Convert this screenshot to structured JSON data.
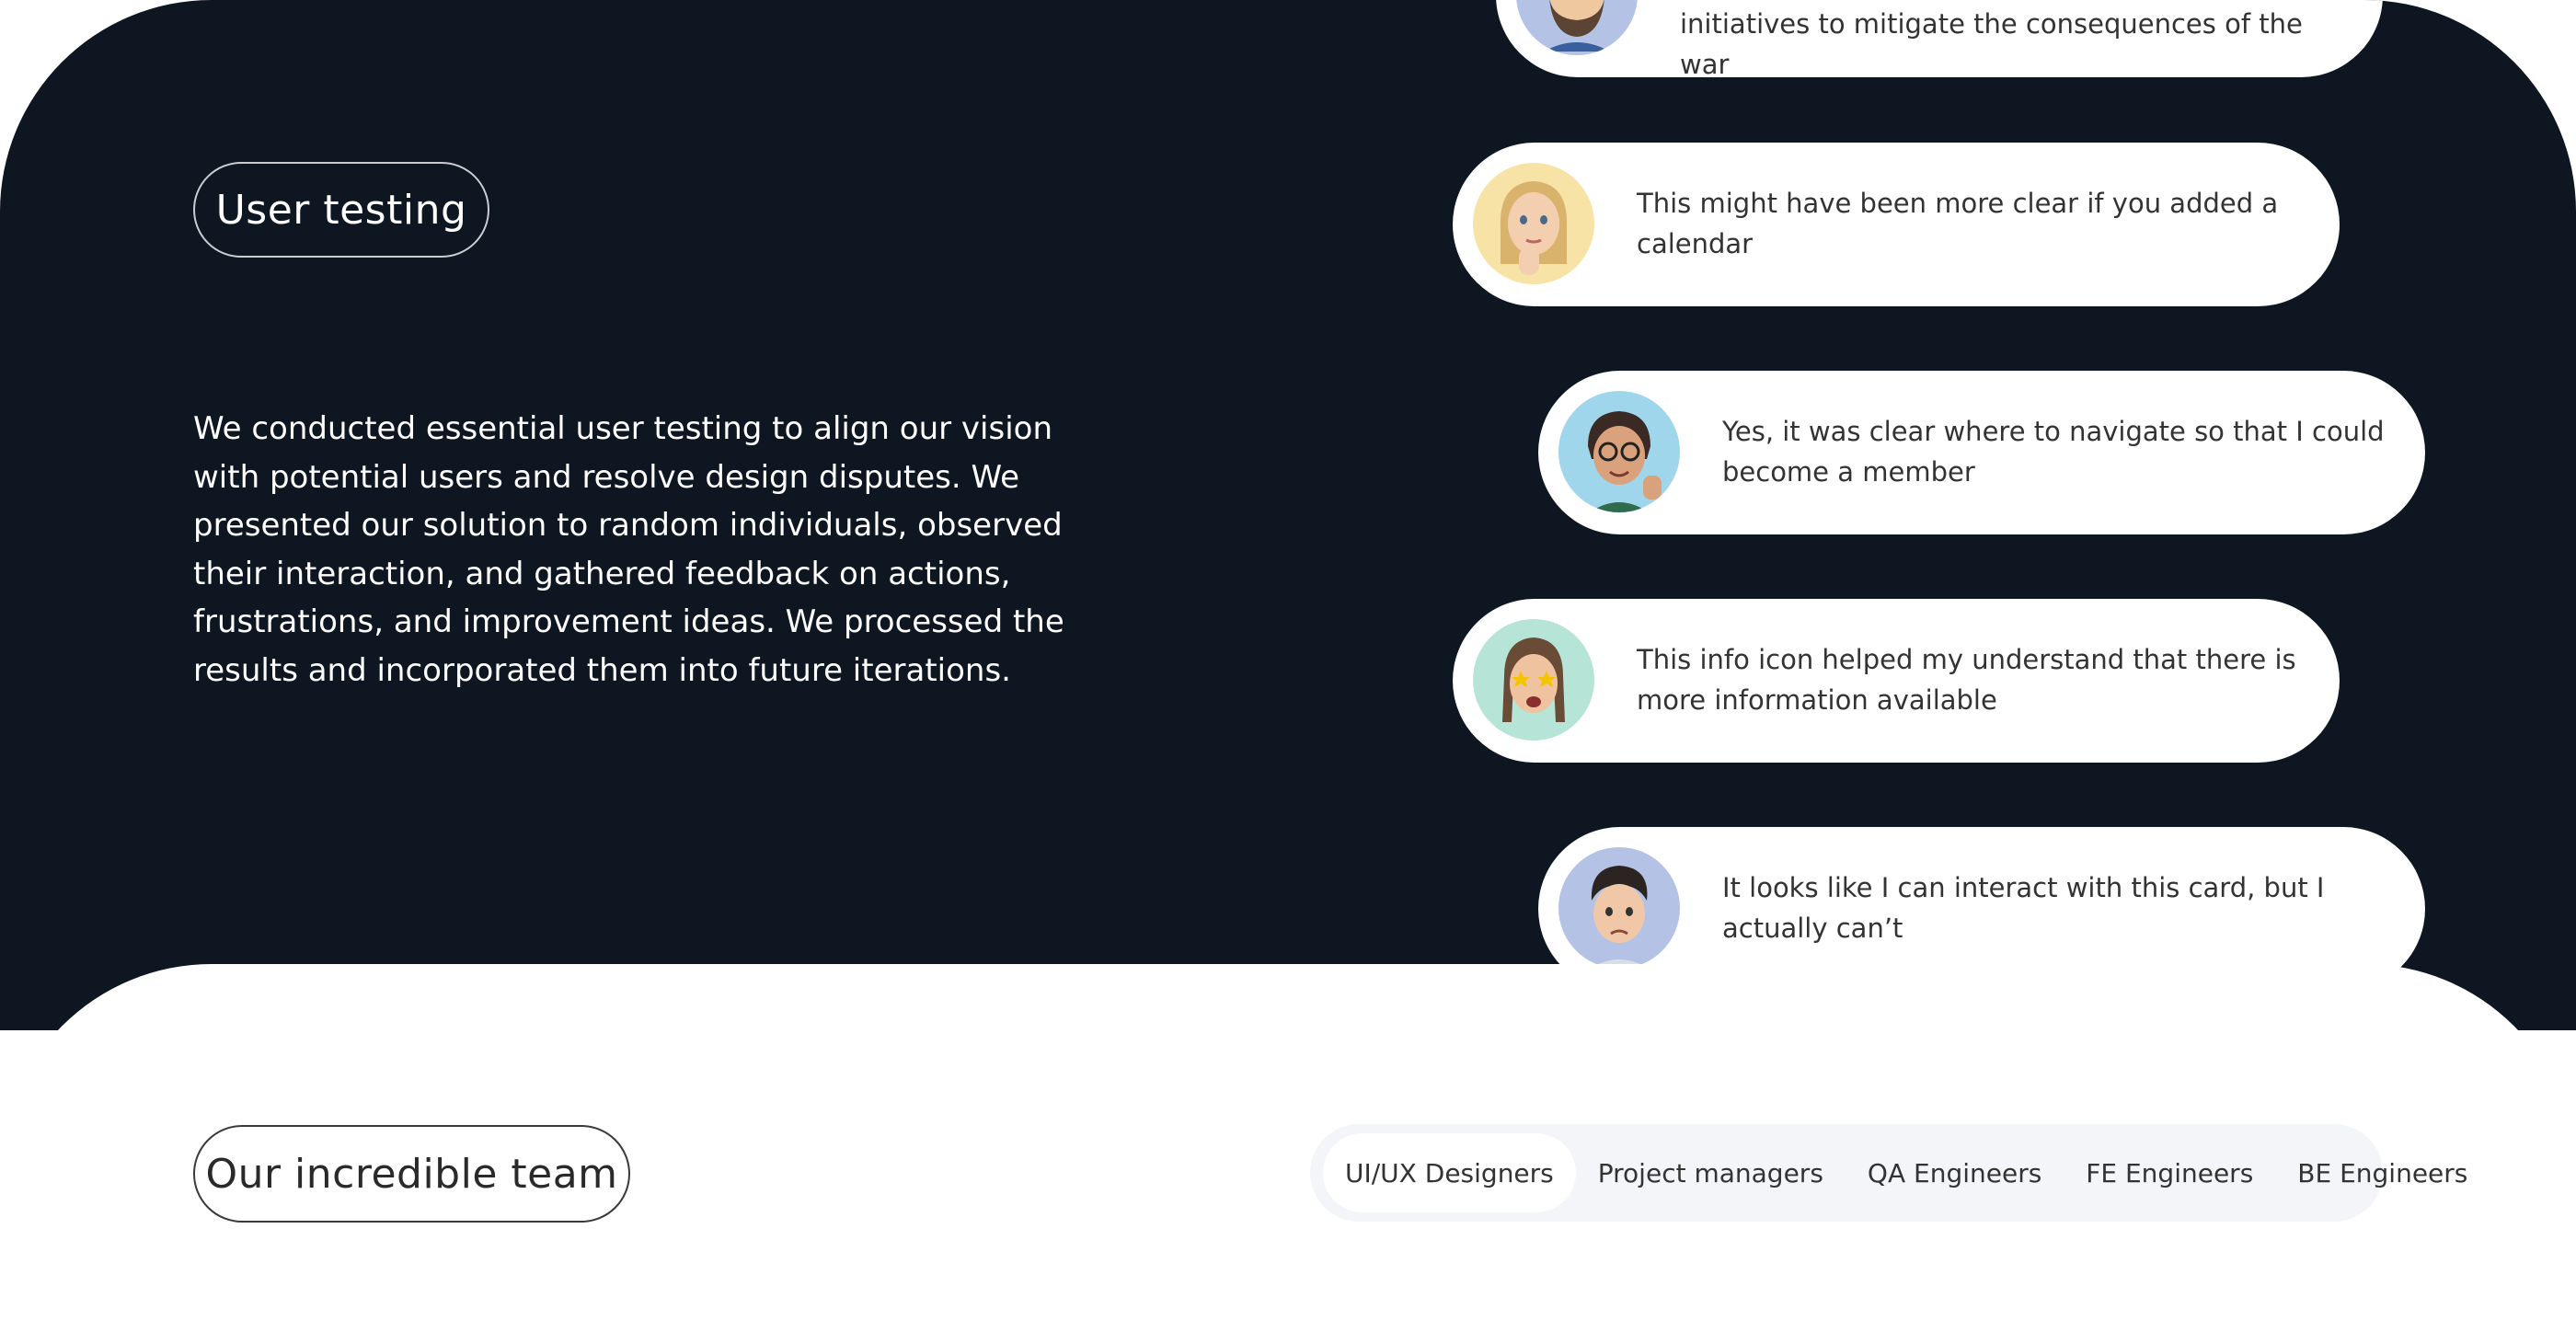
{
  "user_testing": {
    "heading": "User testing",
    "description": "We conducted essential user testing to align our vision with potential users and resolve design disputes. We presented our solution to random individuals, observed their interaction, and gathered feedback on actions, frustrations, and improvement ideas. We processed the results and incorporated them into future iterations."
  },
  "feedback": [
    {
      "text": "initiatives to mitigate the consequences of the war",
      "avatar": "memoji-bearded-man-avatar",
      "avatar_bg": "#b4c2e6"
    },
    {
      "text": "This might have been more clear if you added a calendar",
      "avatar": "memoji-thinking-woman-avatar",
      "avatar_bg": "#f7e3a6"
    },
    {
      "text": "Yes, it was clear where to navigate so that I could become a member",
      "avatar": "memoji-thumbs-up-woman-avatar",
      "avatar_bg": "#9fd6ec"
    },
    {
      "text": "This info icon helped my understand that there is more information available",
      "avatar": "memoji-star-eyes-avatar",
      "avatar_bg": "#b6e4d7"
    },
    {
      "text": "It looks like I can interact with this card, but I actually can’t",
      "avatar": "memoji-sad-man-avatar",
      "avatar_bg": "#b4c2e6"
    }
  ],
  "team": {
    "heading": "Our incredible team",
    "tabs": [
      "UI/UX Designers",
      "Project managers",
      "QA Engineers",
      "FE Engineers",
      "BE Engineers"
    ],
    "active_tab": "UI/UX Designers"
  },
  "colors": {
    "dark_background": "#0d1621",
    "card_background": "#ffffff",
    "tabs_background": "#f4f5f8"
  }
}
